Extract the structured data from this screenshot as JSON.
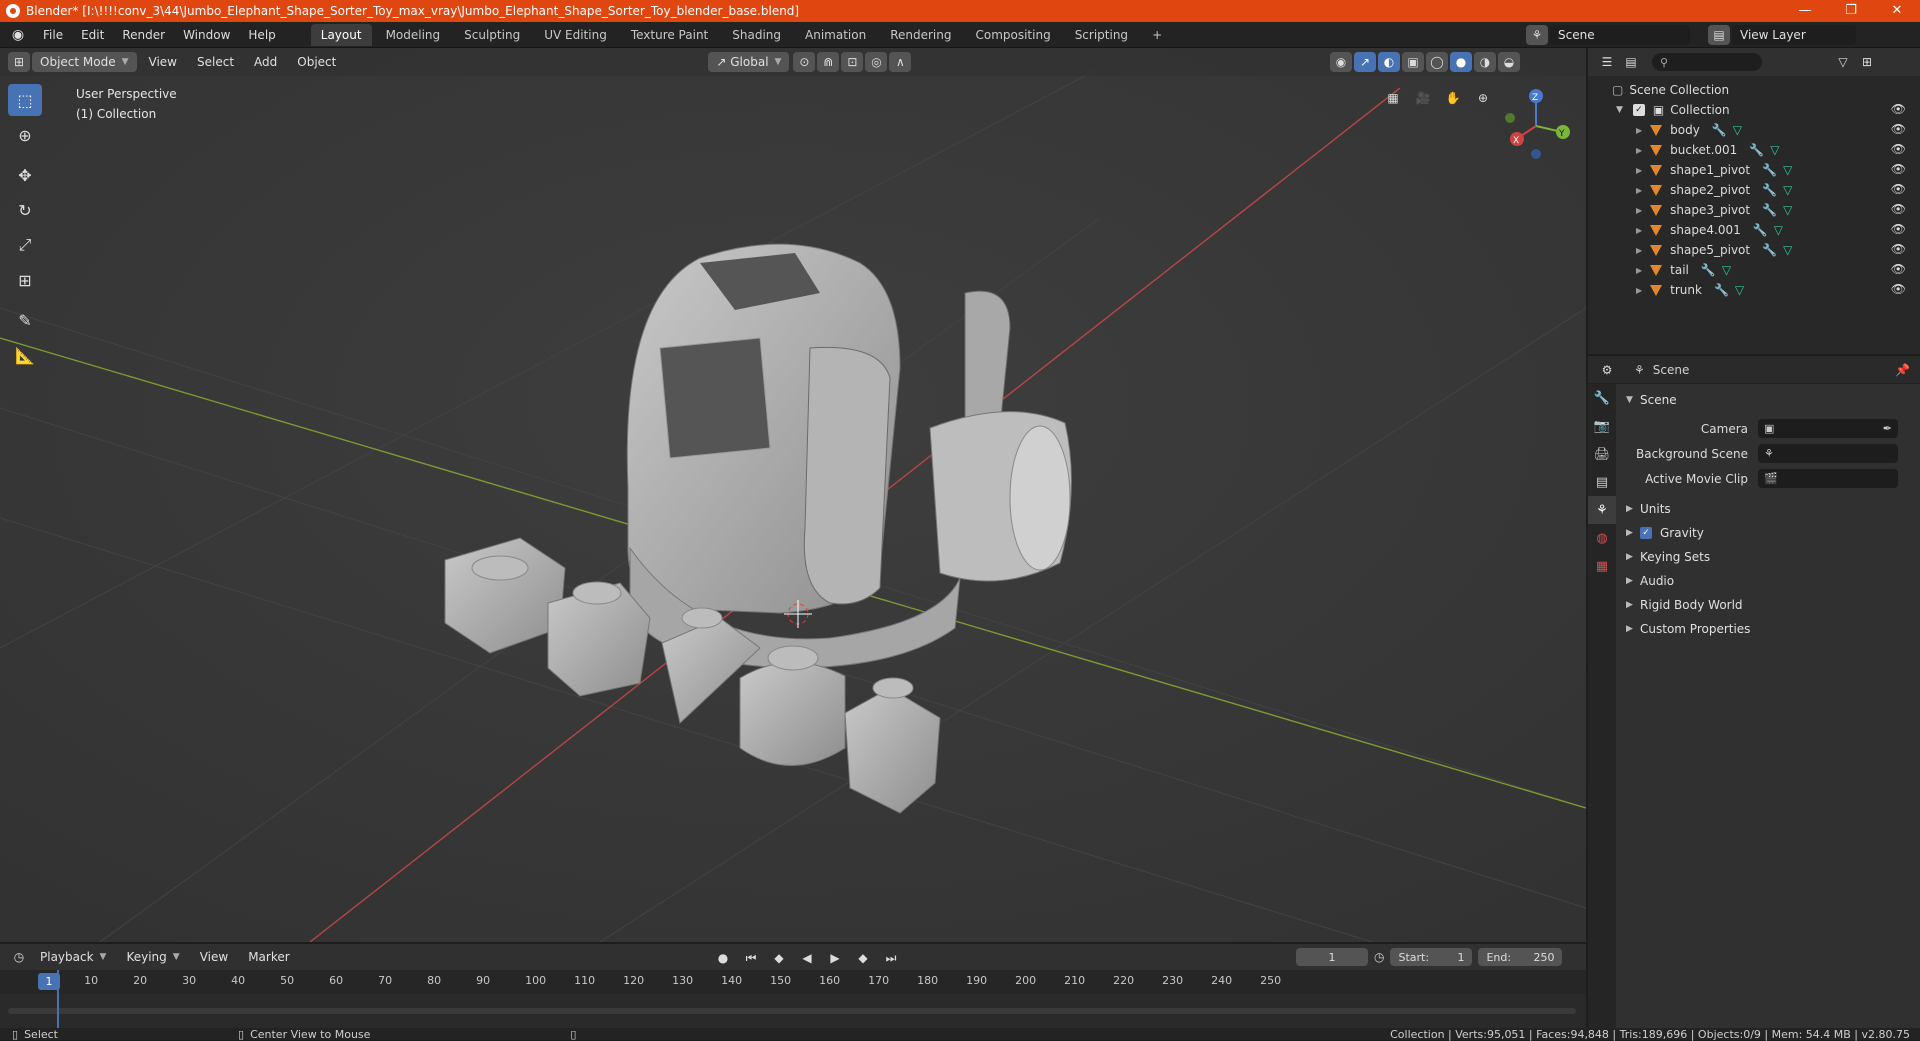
{
  "window": {
    "title": "Blender* [I:\\!!!!conv_3\\44\\Jumbo_Elephant_Shape_Sorter_Toy_max_vray\\Jumbo_Elephant_Shape_Sorter_Toy_blender_base.blend]",
    "min": "—",
    "max": "❐",
    "close": "✕"
  },
  "menus": [
    "File",
    "Edit",
    "Render",
    "Window",
    "Help"
  ],
  "workspaces": [
    "Layout",
    "Modeling",
    "Sculpting",
    "UV Editing",
    "Texture Paint",
    "Shading",
    "Animation",
    "Rendering",
    "Compositing",
    "Scripting"
  ],
  "workspace_add": "+",
  "scene_field": "Scene",
  "view_layer_field": "View Layer",
  "viewport": {
    "mode": "Object Mode",
    "menus": [
      "View",
      "Select",
      "Add",
      "Object"
    ],
    "transform": "Global",
    "info_line1": "User Perspective",
    "info_line2": "(1) Collection",
    "gizmo": {
      "x": "X",
      "y": "Y",
      "z": "Z"
    }
  },
  "outliner": {
    "root": "Scene Collection",
    "collection": "Collection",
    "items": [
      "body",
      "bucket.001",
      "shape1_pivot",
      "shape2_pivot",
      "shape3_pivot",
      "shape4.001",
      "shape5_pivot",
      "tail",
      "trunk"
    ]
  },
  "properties": {
    "header": "Scene",
    "panel": "Scene",
    "fields": [
      {
        "label": "Camera",
        "value": ""
      },
      {
        "label": "Background Scene",
        "value": ""
      },
      {
        "label": "Active Movie Clip",
        "value": ""
      }
    ],
    "collapsed": [
      "Units",
      "Gravity",
      "Keying Sets",
      "Audio",
      "Rigid Body World",
      "Custom Properties"
    ]
  },
  "timeline": {
    "menus": [
      "Playback",
      "Keying",
      "View",
      "Marker"
    ],
    "current_frame": "1",
    "start_label": "Start:",
    "start": "1",
    "end_label": "End:",
    "end": "250",
    "ticks": [
      "1",
      "10",
      "20",
      "30",
      "40",
      "50",
      "60",
      "70",
      "80",
      "90",
      "100",
      "110",
      "120",
      "130",
      "140",
      "150",
      "160",
      "170",
      "180",
      "190",
      "200",
      "210",
      "220",
      "230",
      "240",
      "250"
    ]
  },
  "statusbar": {
    "left1": "Select",
    "left2": "Center View to Mouse",
    "right": "Collection | Verts:95,051 | Faces:94,848 | Tris:189,696 | Objects:0/9 | Mem: 54.4 MB | v2.80.75"
  }
}
